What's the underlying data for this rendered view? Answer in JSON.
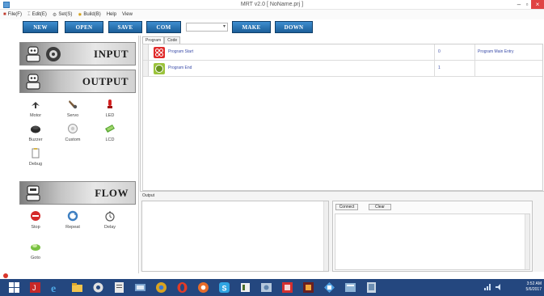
{
  "window": {
    "title": "MRT v2.0 [ NoName.prj ]",
    "min_label": "–",
    "max_label": "▫",
    "close_label": "×"
  },
  "menu": [
    {
      "label": "File(F)"
    },
    {
      "label": "Edit(E)"
    },
    {
      "label": "Set(S)"
    },
    {
      "label": "Build(B)"
    },
    {
      "label": "Help"
    },
    {
      "label": "View"
    }
  ],
  "toolbar": {
    "new_label": "NEW",
    "open_label": "OPEN",
    "save_label": "SAVE",
    "com_label": "COM",
    "make_label": "MAKE",
    "down_label": "DOWN",
    "port_value": ""
  },
  "palette": {
    "input_title": "INPUT",
    "output_title": "OUTPUT",
    "flow_title": "FLOW",
    "output_tools": [
      {
        "label": "Motor",
        "icon": "motor-icon"
      },
      {
        "label": "Servo",
        "icon": "servo-icon"
      },
      {
        "label": "LED",
        "icon": "led-icon"
      },
      {
        "label": "Buzzer",
        "icon": "buzzer-icon"
      },
      {
        "label": "Custom",
        "icon": "custom-icon"
      },
      {
        "label": "LCD",
        "icon": "lcd-icon"
      },
      {
        "label": "Debug",
        "icon": "debug-icon"
      }
    ],
    "flow_tools": [
      {
        "label": "Stop",
        "icon": "stop-icon"
      },
      {
        "label": "Repeat",
        "icon": "repeat-icon"
      },
      {
        "label": "Delay",
        "icon": "delay-icon"
      },
      {
        "label": "Goto",
        "icon": "goto-icon"
      }
    ]
  },
  "program": {
    "tabs": [
      "Program",
      "Code"
    ],
    "rows": [
      {
        "name": "Program Start",
        "number": "0",
        "comment": "Program Main Entry"
      },
      {
        "name": "Program End",
        "number": "1",
        "comment": ""
      }
    ]
  },
  "output": {
    "label": "Output",
    "connect_label": "Connect",
    "clear_label": "Clear"
  },
  "taskbar": {
    "clock_time": "3:52 AM",
    "clock_date": "5/6/2017"
  },
  "colors": {
    "toolbar_button": "#2a6fb0",
    "taskbar": "#24477f",
    "close_button": "#e04343",
    "row_text": "#3a4ca8"
  }
}
